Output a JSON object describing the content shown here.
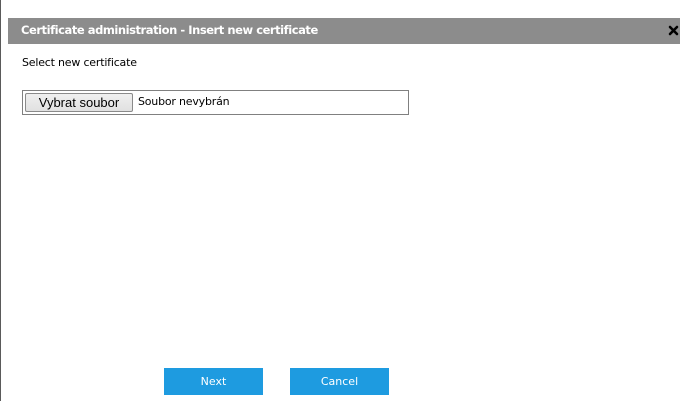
{
  "dialog": {
    "title": "Certificate administration - Insert new certificate",
    "close_icon": "close-icon"
  },
  "form": {
    "label": "Select new certificate",
    "file_button_label": "Vybrat soubor",
    "file_status": "Soubor nevybrán"
  },
  "buttons": {
    "next_label": "Next",
    "cancel_label": "Cancel"
  },
  "colors": {
    "title_bar": "#8c8c8c",
    "primary_button": "#1e9be0"
  }
}
